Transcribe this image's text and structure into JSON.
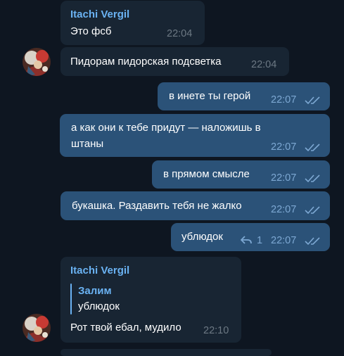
{
  "messages": [
    {
      "dir": "in",
      "sender": "Itachi Vergil",
      "text": "Это фсб",
      "time": "22:04"
    },
    {
      "dir": "in",
      "text": "Пидорам пидорская подсветка",
      "time": "22:04"
    },
    {
      "dir": "out",
      "text": "в инете ты герой",
      "time": "22:07",
      "status": "read"
    },
    {
      "dir": "out",
      "text_lines": [
        "а как они к тебе придут — наложишь в",
        "штаны"
      ],
      "time": "22:07",
      "status": "read"
    },
    {
      "dir": "out",
      "text": "в прямом смысле",
      "time": "22:07",
      "status": "read"
    },
    {
      "dir": "out",
      "text": "букашка. Раздавить тебя не жалко",
      "time": "22:07",
      "status": "read"
    },
    {
      "dir": "out",
      "text": "ублюдок",
      "time": "22:07",
      "status": "read",
      "replies_count": "1"
    },
    {
      "dir": "in",
      "sender": "Itachi Vergil",
      "reply_to": {
        "name": "Залим",
        "text": "ублюдок"
      },
      "text": "Рот твой ебал, мудило",
      "time": "22:10"
    }
  ],
  "colors": {
    "background": "#0e1621",
    "incoming": "#182533",
    "outgoing": "#2b5278",
    "accent": "#6ab2f2"
  }
}
